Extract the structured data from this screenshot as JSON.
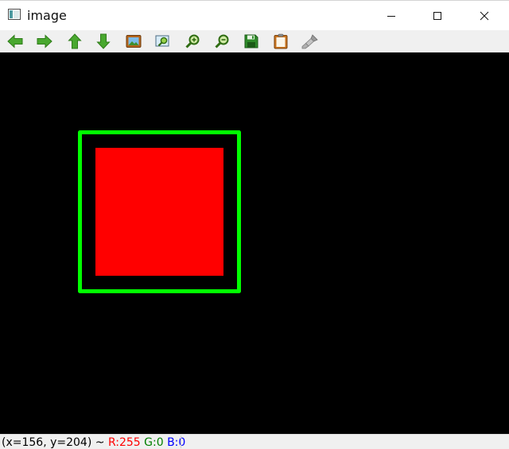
{
  "window": {
    "title": "image"
  },
  "toolbar": {
    "buttons": [
      {
        "icon": "arrow-left-icon"
      },
      {
        "icon": "arrow-right-icon"
      },
      {
        "icon": "arrow-up-icon"
      },
      {
        "icon": "arrow-down-icon"
      },
      {
        "icon": "zoom-fit-icon"
      },
      {
        "icon": "zoom-actual-icon"
      },
      {
        "icon": "zoom-in-icon"
      },
      {
        "icon": "zoom-out-icon"
      },
      {
        "icon": "save-icon"
      },
      {
        "icon": "copy-clipboard-icon"
      },
      {
        "icon": "properties-brush-icon"
      }
    ]
  },
  "canvas": {
    "background_color": "#000000",
    "outer_square_color": "#00ff00",
    "inner_square_color": "#ff0000"
  },
  "status": {
    "coords": "(x=156, y=204) ~ ",
    "r": "R:255",
    "g": "G:0",
    "b": "B:0",
    "r_color": "#ff0000",
    "g_color": "#008000",
    "b_color": "#0000ff"
  }
}
